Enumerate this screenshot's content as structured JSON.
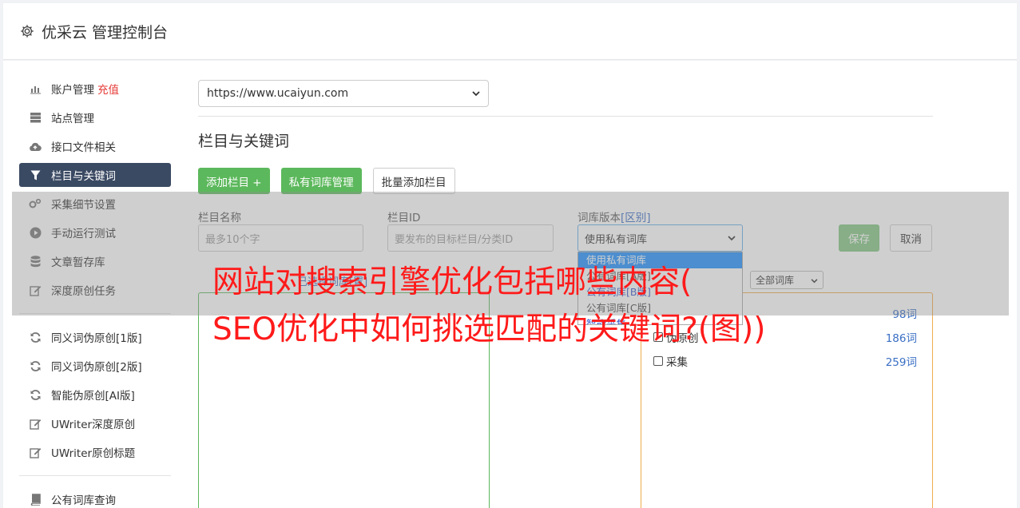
{
  "header": {
    "title": "优采云 管理控制台",
    "icon": "gear-icon"
  },
  "sidebar": {
    "group1": [
      {
        "label": "账户管理",
        "extra": "充值",
        "icon": "bar-chart-icon"
      },
      {
        "label": "站点管理",
        "icon": "server-icon"
      },
      {
        "label": "接口文件相关",
        "icon": "cloud-upload-icon"
      },
      {
        "label": "栏目与关键词",
        "icon": "filter-icon",
        "active": true
      },
      {
        "label": "采集细节设置",
        "icon": "cogs-icon"
      },
      {
        "label": "手动运行测试",
        "icon": "play-circle-icon"
      },
      {
        "label": "文章暂存库",
        "icon": "database-icon"
      },
      {
        "label": "深度原创任务",
        "icon": "edit-icon"
      }
    ],
    "group2": [
      {
        "label": "同义词伪原创[1版]",
        "icon": "refresh-icon"
      },
      {
        "label": "同义词伪原创[2版]",
        "icon": "refresh-icon"
      },
      {
        "label": "智能伪原创[AI版]",
        "icon": "refresh-icon"
      },
      {
        "label": "UWriter深度原创",
        "icon": "edit-icon"
      },
      {
        "label": "UWriter原创标题",
        "icon": "edit-icon"
      }
    ],
    "group3": [
      {
        "label": "公有词库查询",
        "icon": "book-icon"
      }
    ]
  },
  "main": {
    "site_select": "https://www.ucaiyun.com",
    "section_title": "栏目与关键词",
    "buttons": {
      "add_column": "添加栏目 +",
      "private_lib": "私有词库管理",
      "batch_add": "批量添加栏目"
    },
    "form": {
      "name_label": "栏目名称",
      "name_placeholder": "最多10个字",
      "id_label": "栏目ID",
      "id_placeholder": "要发布的目标栏目/分类ID",
      "version_label": "词库版本",
      "version_label_link": "[区别]",
      "version_value": "使用私有词库",
      "save": "保存",
      "cancel": "取消"
    },
    "dropdown_options": [
      "使用私有词库",
      "公有词库[A版]",
      "公有词库[B版]",
      "公有词库[C版]",
      "智能采集"
    ],
    "center_link": "已选择词库[置]",
    "all_lib_select": "全部词库",
    "libs": [
      {
        "name": "",
        "count": "98词"
      },
      {
        "name": "伪原创",
        "count": "186词"
      },
      {
        "name": "采集",
        "count": "259词"
      }
    ]
  },
  "overlay": {
    "line1": "网站对搜索引擎优化包括哪些内容(",
    "line2": "SEO优化中如何挑选匹配的关键词?(图))"
  }
}
